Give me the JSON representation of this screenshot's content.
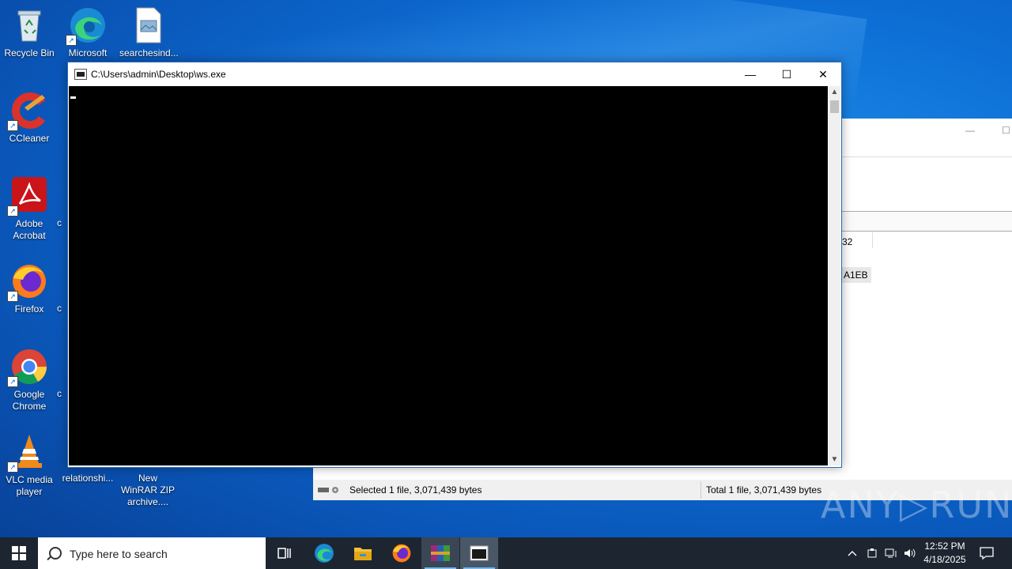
{
  "desktop": {
    "icons": [
      {
        "label": "Recycle Bin"
      },
      {
        "label": "Microsoft Edge"
      },
      {
        "label": "searchesind..."
      },
      {
        "label": "CCleaner"
      },
      {
        "label": "Adobe Acrobat"
      },
      {
        "label": "Firefox"
      },
      {
        "label": "Google Chrome"
      },
      {
        "label": "VLC media player"
      },
      {
        "label": "relationshi..."
      },
      {
        "label": "New WinRAR ZIP archive...."
      }
    ],
    "partial_labels": [
      "c",
      "c",
      "c"
    ]
  },
  "console": {
    "title": "C:\\Users\\admin\\Desktop\\ws.exe",
    "minimize": "—",
    "maximize": "☐",
    "close": "✕"
  },
  "background_window": {
    "cell1": "32",
    "cell2": "A1EB",
    "status_selected": "Selected 1 file, 3,071,439 bytes",
    "status_total": "Total 1 file, 3,071,439 bytes"
  },
  "watermark": "ANY▷RUN",
  "taskbar": {
    "search_placeholder": "Type here to search",
    "time": "12:52 PM",
    "date": "4/18/2025",
    "apps": [
      "task-view",
      "edge",
      "file-explorer",
      "firefox",
      "winrar",
      "console"
    ]
  },
  "colors": {
    "taskbar_bg": "#1d2530",
    "desktop_accent": "#0d6fd6",
    "console_bg": "#000000"
  }
}
